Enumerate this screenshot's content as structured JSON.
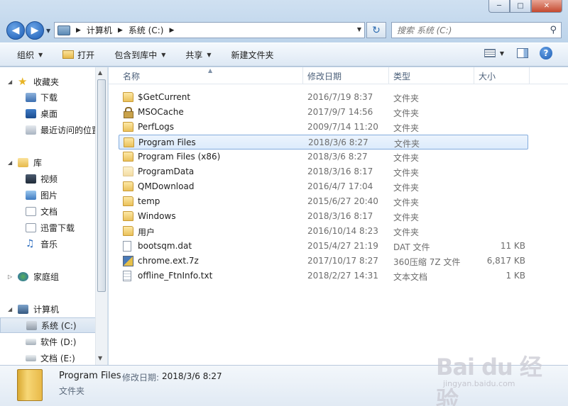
{
  "window": {
    "minimize_label": "─",
    "maximize_label": "□",
    "close_label": "✕"
  },
  "address": {
    "crumbs": [
      "计算机",
      "系统 (C:)"
    ]
  },
  "search": {
    "placeholder": "搜索 系统 (C:)"
  },
  "toolbar": {
    "organize": "组织",
    "open": "打开",
    "include_in_library": "包含到库中",
    "share": "共享",
    "new_folder": "新建文件夹"
  },
  "navpane": {
    "favorites": {
      "label": "收藏夹",
      "items": [
        "下载",
        "桌面",
        "最近访问的位置"
      ]
    },
    "libraries": {
      "label": "库",
      "items": [
        "视频",
        "图片",
        "文档",
        "迅雷下载",
        "音乐"
      ]
    },
    "homegroup": {
      "label": "家庭组"
    },
    "computer": {
      "label": "计算机",
      "items": [
        "系统 (C:)",
        "软件 (D:)",
        "文档 (E:)"
      ]
    }
  },
  "columns": {
    "name": "名称",
    "date": "修改日期",
    "type": "类型",
    "size": "大小"
  },
  "files": [
    {
      "name": "$GetCurrent",
      "date": "2016/7/19 8:37",
      "type": "文件夹",
      "size": "",
      "icon": "folder-icon"
    },
    {
      "name": "MSOCache",
      "date": "2017/9/7 14:56",
      "type": "文件夹",
      "size": "",
      "icon": "lock-icon"
    },
    {
      "name": "PerfLogs",
      "date": "2009/7/14 11:20",
      "type": "文件夹",
      "size": "",
      "icon": "folder-icon"
    },
    {
      "name": "Program Files",
      "date": "2018/3/6 8:27",
      "type": "文件夹",
      "size": "",
      "icon": "folder-icon"
    },
    {
      "name": "Program Files (x86)",
      "date": "2018/3/6 8:27",
      "type": "文件夹",
      "size": "",
      "icon": "folder-icon"
    },
    {
      "name": "ProgramData",
      "date": "2018/3/16 8:17",
      "type": "文件夹",
      "size": "",
      "icon": "folder-icon"
    },
    {
      "name": "QMDownload",
      "date": "2016/4/7 17:04",
      "type": "文件夹",
      "size": "",
      "icon": "folder-icon"
    },
    {
      "name": "temp",
      "date": "2015/6/27 20:40",
      "type": "文件夹",
      "size": "",
      "icon": "folder-icon"
    },
    {
      "name": "Windows",
      "date": "2018/3/16 8:17",
      "type": "文件夹",
      "size": "",
      "icon": "folder-icon"
    },
    {
      "name": "用户",
      "date": "2016/10/14 8:23",
      "type": "文件夹",
      "size": "",
      "icon": "folder-icon"
    },
    {
      "name": "bootsqm.dat",
      "date": "2015/4/27 21:19",
      "type": "DAT 文件",
      "size": "11 KB",
      "icon": "file-icon"
    },
    {
      "name": "chrome.ext.7z",
      "date": "2017/10/17 8:27",
      "type": "360压缩 7Z 文件",
      "size": "6,817 KB",
      "icon": "archive-icon"
    },
    {
      "name": "offline_FtnInfo.txt",
      "date": "2018/2/27 14:31",
      "type": "文本文档",
      "size": "1 KB",
      "icon": "text-file-icon"
    }
  ],
  "details": {
    "name": "Program Files",
    "date_label": "修改日期:",
    "date": "2018/3/6 8:27",
    "type": "文件夹"
  },
  "watermark": {
    "text": "Bai du 经验",
    "sub": "jingyan.baidu.com"
  }
}
